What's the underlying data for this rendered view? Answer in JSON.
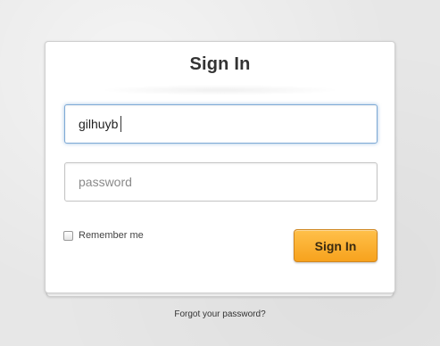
{
  "form": {
    "title": "Sign In",
    "username_value": "gilhuyb",
    "password_placeholder": "password",
    "remember_label": "Remember me",
    "remember_checked": false,
    "submit_label": "Sign In"
  },
  "footer": {
    "forgot_label": "Forgot your password?"
  },
  "colors": {
    "button_accent": "#f7a21d",
    "focus_border": "#7eaad6"
  }
}
